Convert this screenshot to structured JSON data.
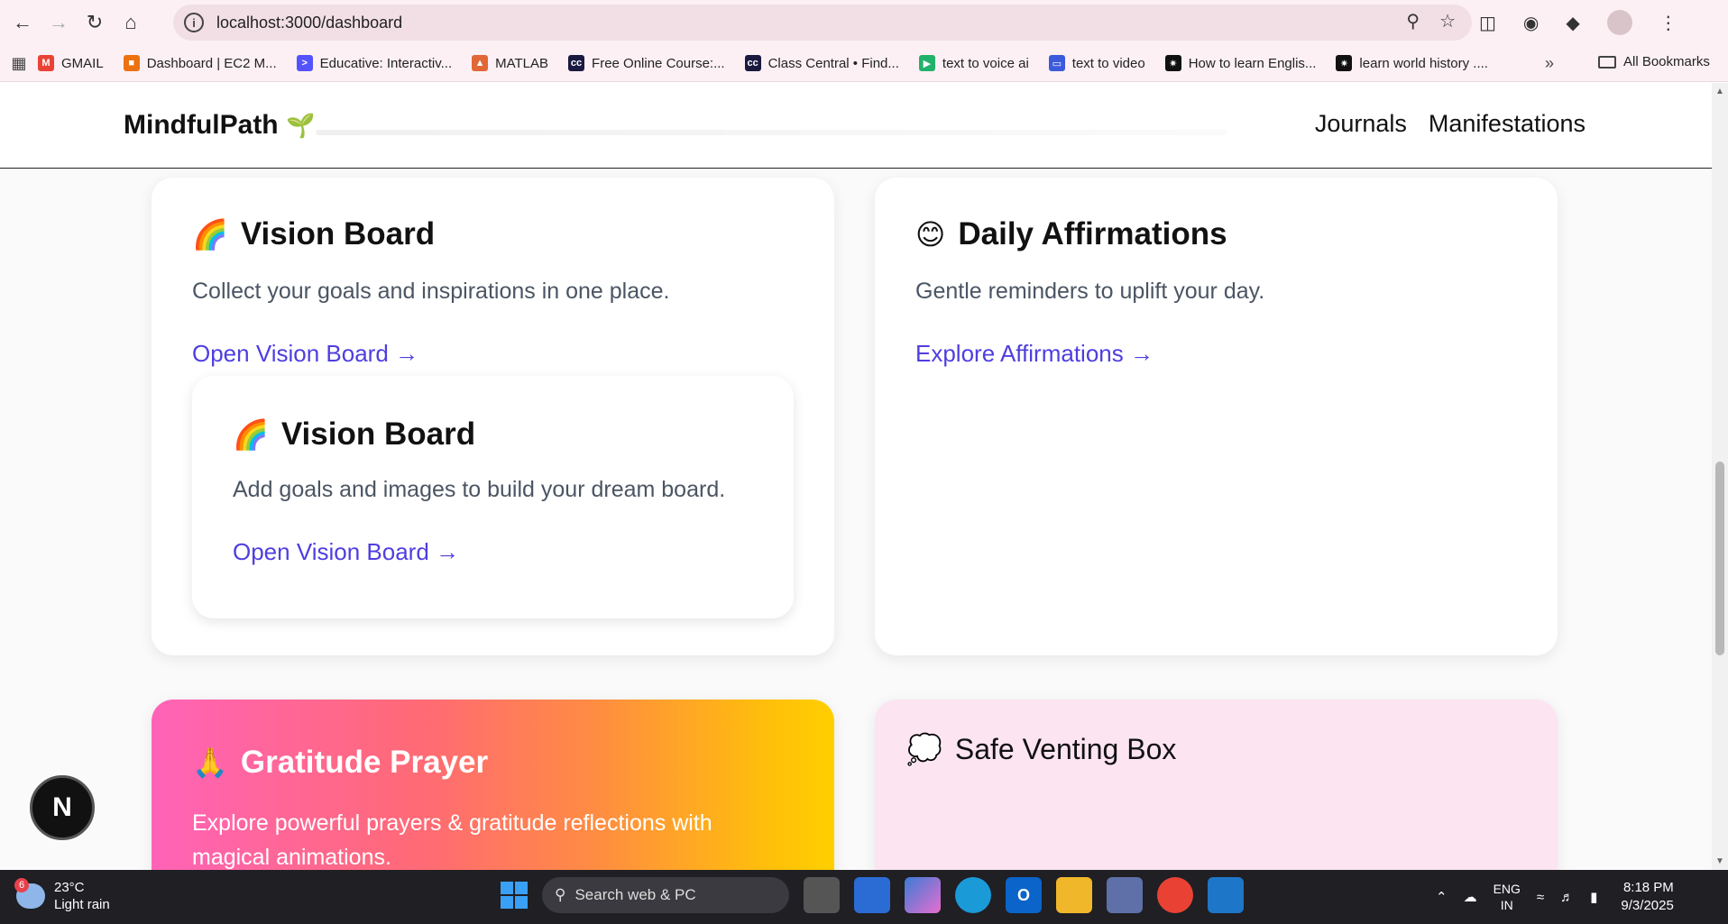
{
  "browser": {
    "url": "localhost:3000/dashboard",
    "bookmarks": [
      {
        "label": "GMAIL",
        "color": "#ea4335",
        "glyph": "M"
      },
      {
        "label": "Dashboard | EC2 M...",
        "color": "#ec7211",
        "glyph": "■"
      },
      {
        "label": "Educative: Interactiv...",
        "color": "#5553ff",
        "glyph": ">"
      },
      {
        "label": "MATLAB",
        "color": "#e16737",
        "glyph": "▲"
      },
      {
        "label": "Free Online Course:...",
        "color": "#1a1a40",
        "glyph": "cc"
      },
      {
        "label": "Class Central • Find...",
        "color": "#1a1a40",
        "glyph": "cc"
      },
      {
        "label": "text to voice ai",
        "color": "#20b26b",
        "glyph": "▶"
      },
      {
        "label": "text to video",
        "color": "#3b5bdb",
        "glyph": "▭"
      },
      {
        "label": "How to learn Englis...",
        "color": "#111111",
        "glyph": "✷"
      },
      {
        "label": "learn world history ....",
        "color": "#111111",
        "glyph": "✷"
      }
    ],
    "all_bookmarks": "All Bookmarks"
  },
  "app": {
    "brand": "MindfulPath",
    "brand_emoji": "🌱",
    "nav": [
      "Journals",
      "Manifestations"
    ]
  },
  "cards": {
    "vision": {
      "emoji": "🌈",
      "title": "Vision Board",
      "desc": "Collect your goals and inspirations in one place.",
      "link": "Open Vision Board →",
      "inner": {
        "emoji": "🌈",
        "title": "Vision Board",
        "desc": "Add goals and images to build your dream board.",
        "link": "Open Vision Board →"
      }
    },
    "affirmations": {
      "emoji": "😊",
      "title": "Daily Affirmations",
      "desc": "Gentle reminders to uplift your day.",
      "link": "Explore Affirmations →"
    },
    "gratitude": {
      "emoji": "🙏",
      "title": "Gratitude Prayer",
      "desc": "Explore powerful prayers & gratitude reflections with magical animations."
    },
    "venting": {
      "emoji": "💭",
      "title": "Safe Venting Box"
    }
  },
  "dev_badge": "N",
  "taskbar": {
    "weather_temp": "23°C",
    "weather_desc": "Light rain",
    "weather_badge": "6",
    "search_placeholder": "Search web & PC",
    "lang_top": "ENG",
    "lang_bottom": "IN",
    "time": "8:18 PM",
    "date": "9/3/2025"
  }
}
